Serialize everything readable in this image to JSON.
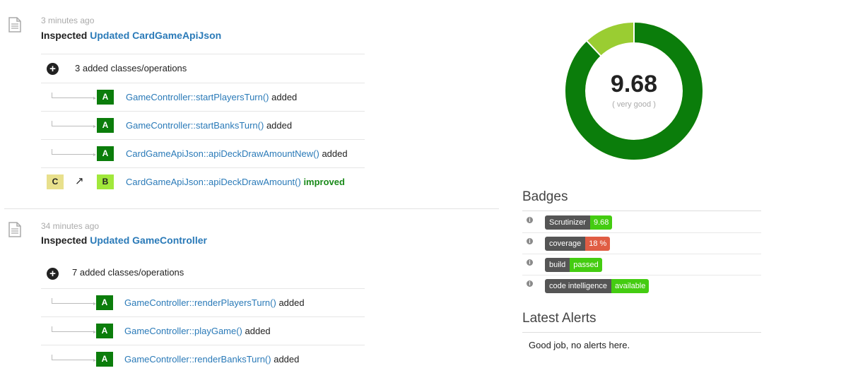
{
  "feed": [
    {
      "time": "3 minutes ago",
      "verb": "Inspected",
      "link": "Updated CardGameApiJson",
      "summary": "3 added classes/operations",
      "ops": [
        {
          "from": "",
          "to": "A",
          "name": "GameController::startPlayersTurn()",
          "change": "added"
        },
        {
          "from": "",
          "to": "A",
          "name": "GameController::startBanksTurn()",
          "change": "added"
        },
        {
          "from": "",
          "to": "A",
          "name": "CardGameApiJson::apiDeckDrawAmountNew()",
          "change": "added"
        },
        {
          "from": "C",
          "to": "B",
          "arrow": "↗",
          "name": "CardGameApiJson::apiDeckDrawAmount()",
          "change": "improved"
        }
      ]
    },
    {
      "time": "34 minutes ago",
      "verb": "Inspected",
      "link": "Updated GameController",
      "summary": "7 added classes/operations",
      "ops": [
        {
          "from": "",
          "to": "A",
          "name": "GameController::renderPlayersTurn()",
          "change": "added"
        },
        {
          "from": "",
          "to": "A",
          "name": "GameController::playGame()",
          "change": "added"
        },
        {
          "from": "",
          "to": "A",
          "name": "GameController::renderBanksTurn()",
          "change": "added"
        }
      ]
    }
  ],
  "score": {
    "value": "9.68",
    "label": "( very good )",
    "fraction": 0.88,
    "color_main": "#0b7d0b",
    "color_rest": "#9acd32"
  },
  "badges": {
    "title": "Badges",
    "items": [
      {
        "left": "Scrutinizer",
        "right": "9.68",
        "color": "#4c1"
      },
      {
        "left": "coverage",
        "right": "18 %",
        "color": "#e05d44"
      },
      {
        "left": "build",
        "right": "passed",
        "color": "#4c1"
      },
      {
        "left": "code intelligence",
        "right": "available",
        "color": "#4c1"
      }
    ]
  },
  "alerts": {
    "title": "Latest Alerts",
    "text": "Good job, no alerts here."
  }
}
